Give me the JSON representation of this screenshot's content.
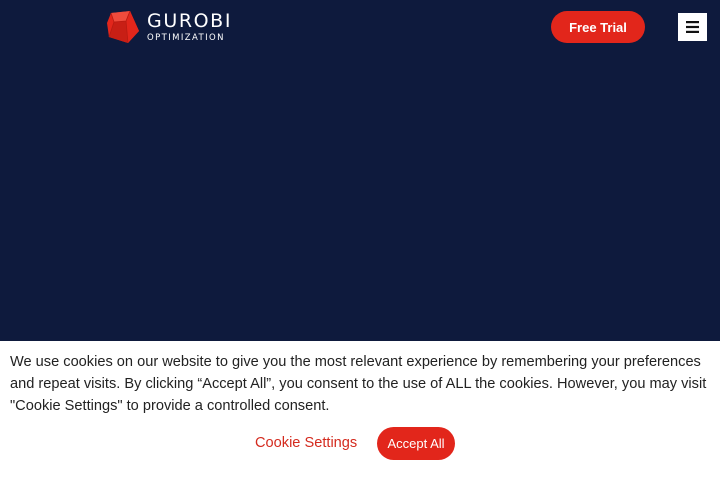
{
  "header": {
    "logo": {
      "icon": "gurobi-cube-icon",
      "name": "GUROBI",
      "subtitle": "OPTIMIZATION"
    },
    "free_trial_label": "Free Trial",
    "menu_icon": "hamburger-menu-icon"
  },
  "cookie_banner": {
    "message": "We use cookies on our website to give you the most relevant experience by remembering your preferences and repeat visits. By clicking “Accept All”, you consent to the use of ALL the cookies. However, you may visit \"Cookie Settings\" to provide a controlled consent.",
    "settings_label": "Cookie Settings",
    "accept_label": "Accept All"
  },
  "colors": {
    "background": "#0e1a3d",
    "accent": "#e2261b",
    "banner": "#ffffff"
  }
}
